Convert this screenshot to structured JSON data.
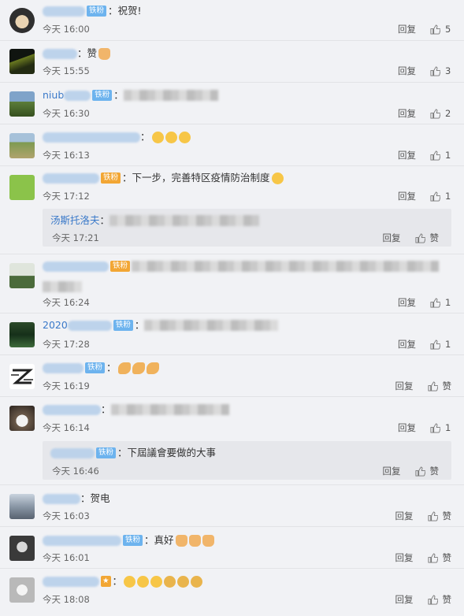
{
  "comments": [
    {
      "text": "：祝贺!",
      "time": "今天 16:00",
      "reply": "回复",
      "likes": "5"
    },
    {
      "text": "：赞",
      "time": "今天 15:55",
      "reply": "回复",
      "likes": "3"
    },
    {
      "name_visible": "niub",
      "time": "今天 16:30",
      "reply": "回复",
      "likes": "2"
    },
    {
      "text": "",
      "time": "今天 16:13",
      "reply": "回复",
      "likes": "1"
    },
    {
      "text": "：下一步，完善特区疫情防治制度",
      "time": "今天 17:12",
      "reply": "回复",
      "likes": "1",
      "sub": {
        "name": "汤斯托洛夫",
        "time": "今天 17:21",
        "reply": "回复",
        "like_label": "赞"
      }
    },
    {
      "time": "今天 16:24",
      "reply": "回复",
      "likes": "1"
    },
    {
      "name_visible": "2020",
      "time": "今天 17:28",
      "reply": "回复",
      "likes": "1"
    },
    {
      "time": "今天 16:19",
      "reply": "回复",
      "like_label": "赞"
    },
    {
      "time": "今天 16:14",
      "reply": "回复",
      "likes": "1",
      "sub": {
        "text": "：下屆議會要做的大事",
        "time": "今天 16:46",
        "reply": "回复",
        "like_label": "赞"
      }
    },
    {
      "text": "：贺电",
      "time": "今天 16:03",
      "reply": "回复",
      "like_label": "赞"
    },
    {
      "text": "：真好",
      "time": "今天 16:01",
      "reply": "回复",
      "like_label": "赞"
    },
    {
      "time": "今天 18:08",
      "reply": "回复",
      "like_label": "赞"
    }
  ],
  "fan_badge": "铁粉",
  "colors": {
    "name": "#3a79c9",
    "badge": "#6db3ee",
    "bg": "#f1f2f5",
    "sub_bg": "#e6e7eb"
  }
}
